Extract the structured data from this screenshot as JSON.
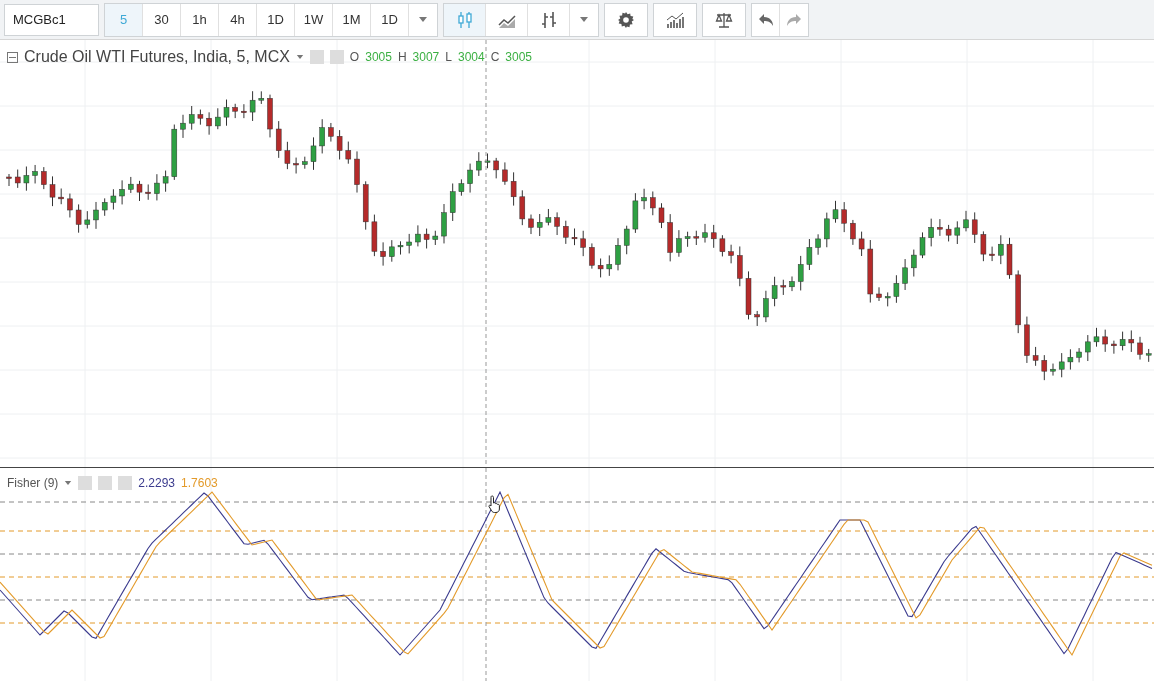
{
  "toolbar": {
    "symbol": "MCGBc1",
    "intervals": [
      {
        "label": "5",
        "selected": true
      },
      {
        "label": "30",
        "selected": false
      },
      {
        "label": "1h",
        "selected": false
      },
      {
        "label": "4h",
        "selected": false
      },
      {
        "label": "1D",
        "selected": false
      },
      {
        "label": "1W",
        "selected": false
      },
      {
        "label": "1M",
        "selected": false
      },
      {
        "label": "1D",
        "selected": false
      }
    ],
    "chart_styles": [
      {
        "kind": "candles",
        "selected": true
      },
      {
        "kind": "line",
        "selected": false
      },
      {
        "kind": "bars",
        "selected": false
      }
    ]
  },
  "legend": {
    "title": "Crude Oil WTI Futures, India, 5, MCX",
    "values": [
      {
        "label": "O",
        "value": "3005"
      },
      {
        "label": "H",
        "value": "3007"
      },
      {
        "label": "L",
        "value": "3004"
      },
      {
        "label": "C",
        "value": "3005"
      }
    ]
  },
  "indicator": {
    "title": "Fisher (9)",
    "values": [
      {
        "value": "2.2293",
        "color": "#3b3b8e"
      },
      {
        "value": "1.7603",
        "color": "#e39a2a"
      }
    ]
  }
}
